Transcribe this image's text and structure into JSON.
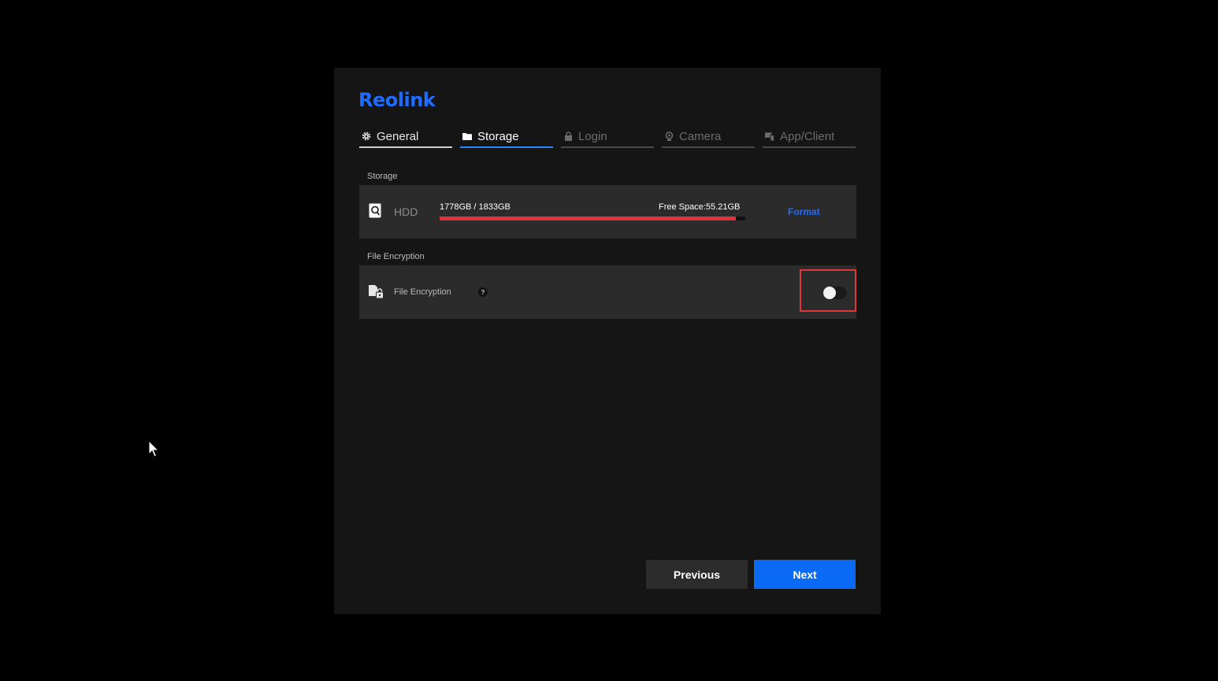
{
  "brand": {
    "name": "Reolink",
    "color": "#1f6cff"
  },
  "tabs": [
    {
      "label": "General",
      "icon": "gear-icon",
      "state": "done"
    },
    {
      "label": "Storage",
      "icon": "folder-icon",
      "state": "active"
    },
    {
      "label": "Login",
      "icon": "lock-icon",
      "state": "pending"
    },
    {
      "label": "Camera",
      "icon": "camera-icon",
      "state": "pending"
    },
    {
      "label": "App/Client",
      "icon": "devices-icon",
      "state": "pending"
    }
  ],
  "storage": {
    "section_label": "Storage",
    "device_name": "HDD",
    "used_text": "1778GB / 1833GB",
    "free_text": "Free Space:55.21GB",
    "usage_fraction": 0.97,
    "usage_color": "#e8303d",
    "format_label": "Format"
  },
  "encryption": {
    "section_label": "File Encryption",
    "label": "File Encryption",
    "help_glyph": "?",
    "enabled": false
  },
  "buttons": {
    "previous": "Previous",
    "next": "Next"
  }
}
